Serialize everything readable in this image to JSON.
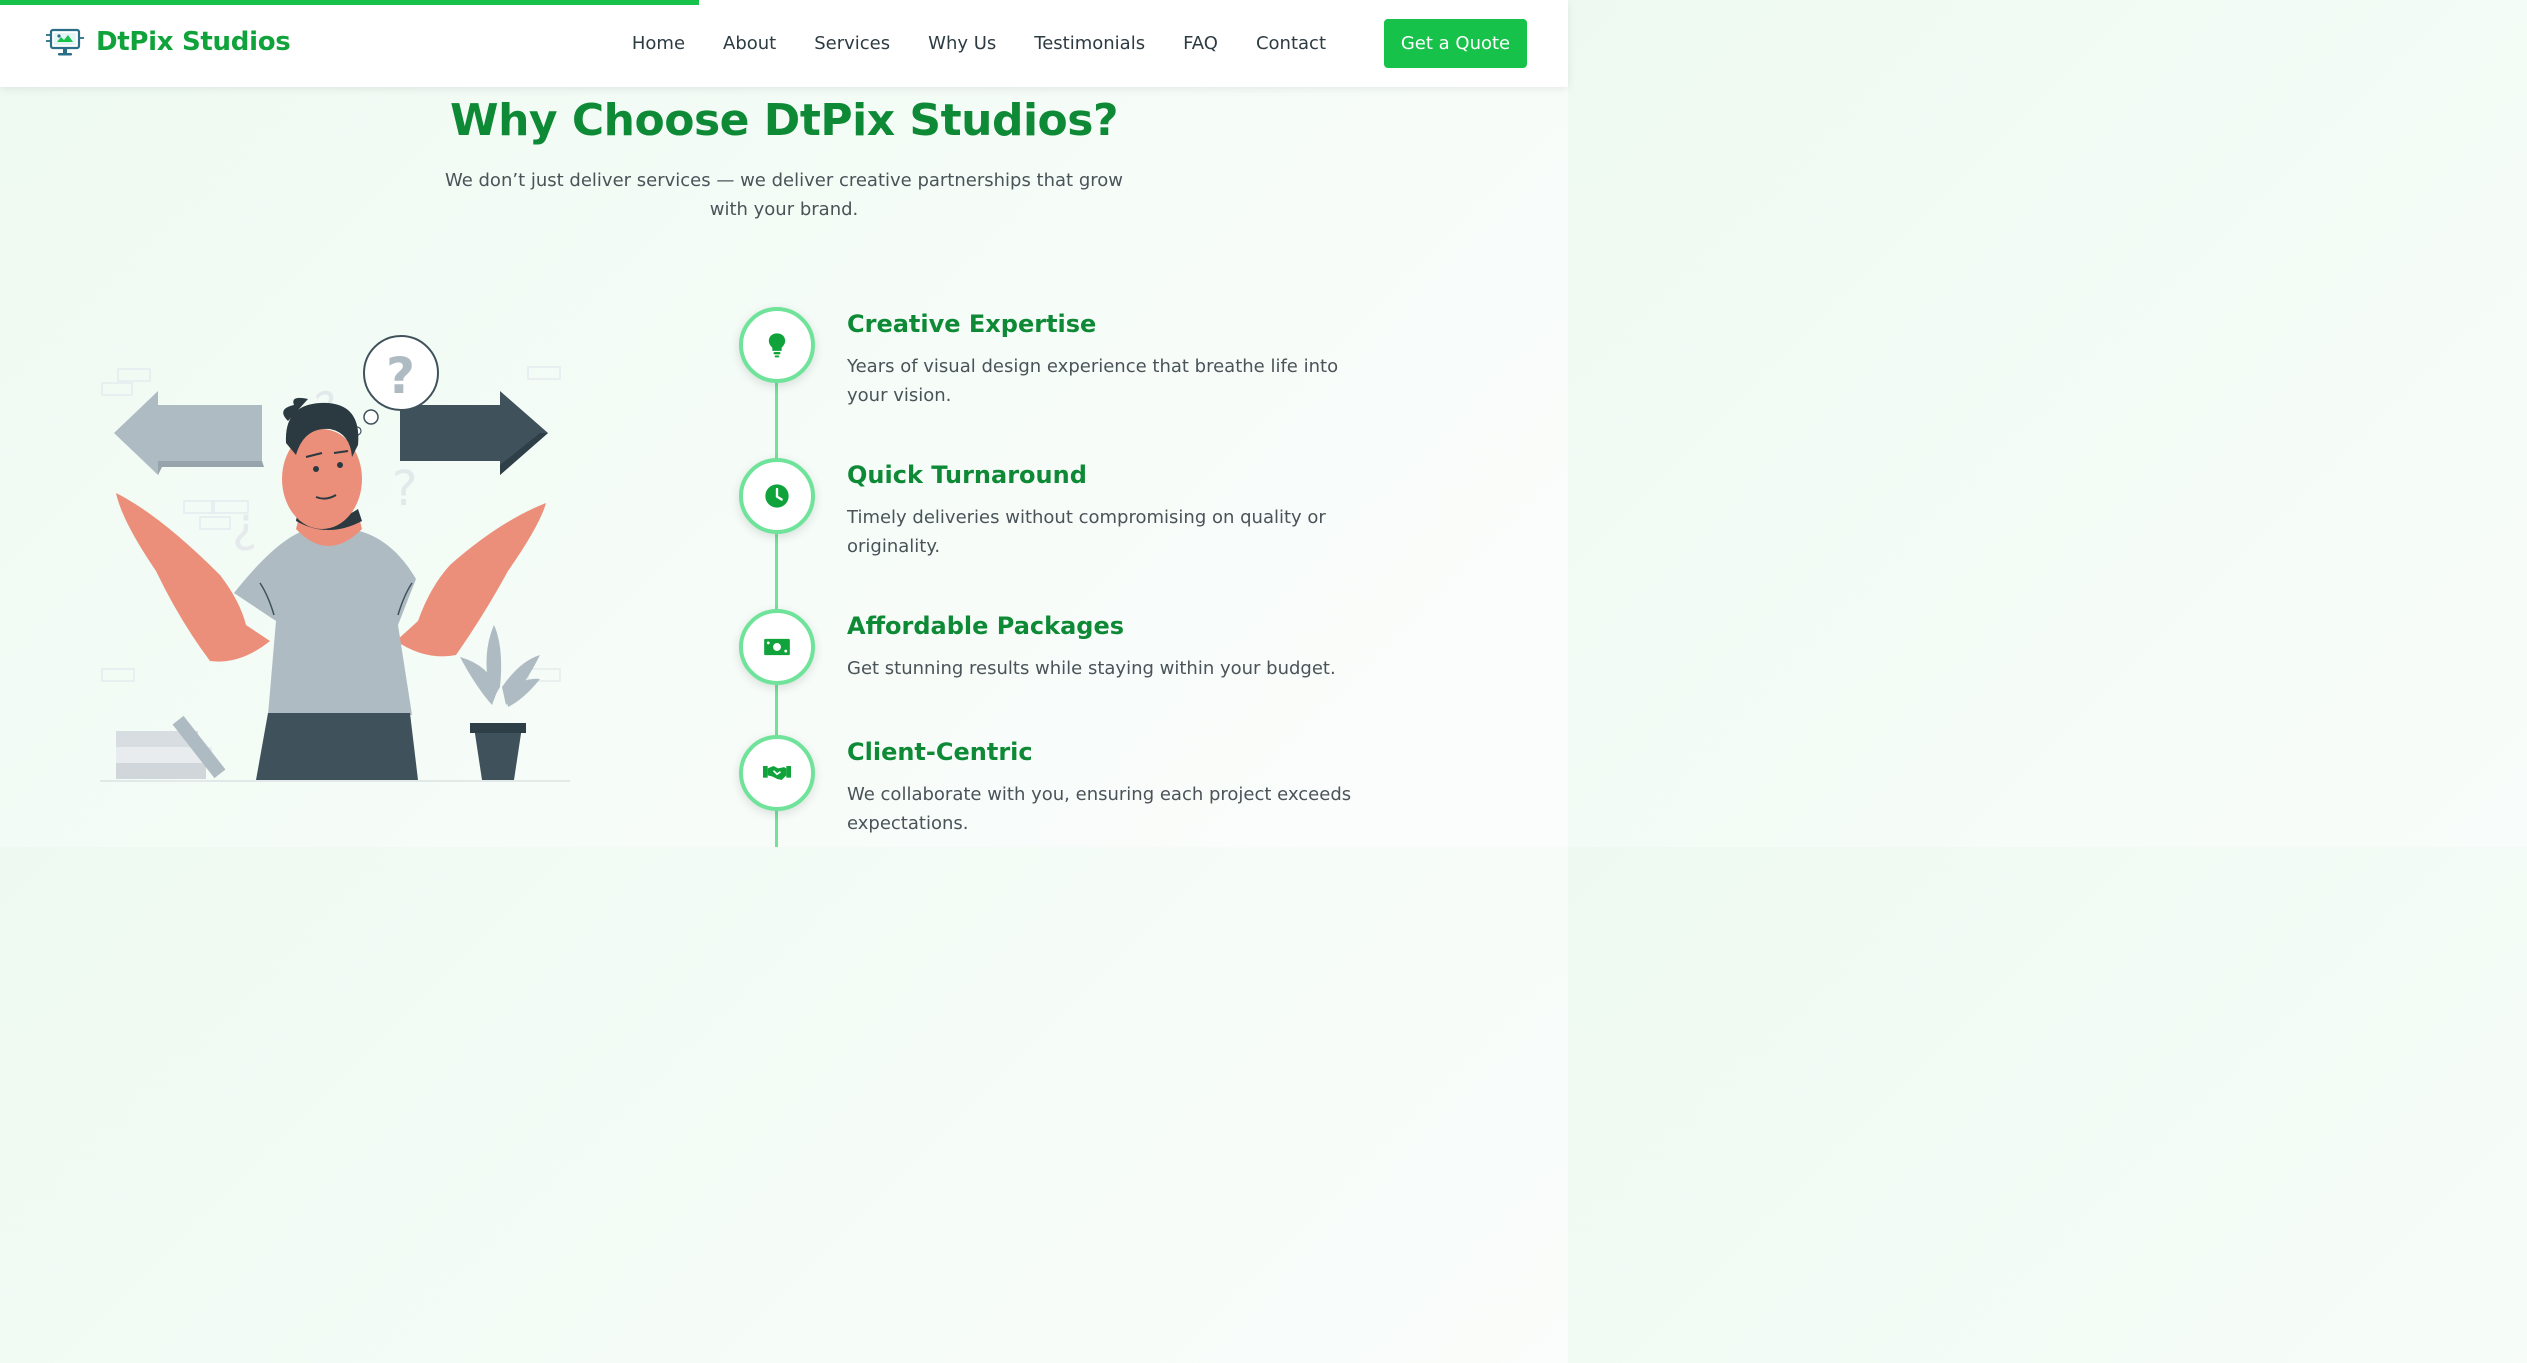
{
  "header": {
    "brand_name": "DtPix Studios",
    "nav": [
      "Home",
      "About",
      "Services",
      "Why Us",
      "Testimonials",
      "FAQ",
      "Contact"
    ],
    "cta_label": "Get a Quote",
    "scroll_progress": 0.446
  },
  "section": {
    "title": "Why Choose DtPix Studios?",
    "subtitle": "We don’t just deliver services — we deliver creative partnerships that grow with your brand."
  },
  "features": [
    {
      "icon": "lightbulb-icon",
      "title": "Creative Expertise",
      "desc": "Years of visual design experience that breathe life into your vision."
    },
    {
      "icon": "clock-icon",
      "title": "Quick Turnaround",
      "desc": "Timely deliveries without compromising on quality or originality."
    },
    {
      "icon": "money-icon",
      "title": "Affordable Packages",
      "desc": "Get stunning results while staying within your budget."
    },
    {
      "icon": "handshake-icon",
      "title": "Client-Centric",
      "desc": "We collaborate with you, ensuring each project exceeds expectations."
    }
  ],
  "colors": {
    "brand_green": "#11a33b",
    "title_green": "#0e8a36",
    "button_green": "#16c24a",
    "timeline_green": "#6fe39a"
  }
}
